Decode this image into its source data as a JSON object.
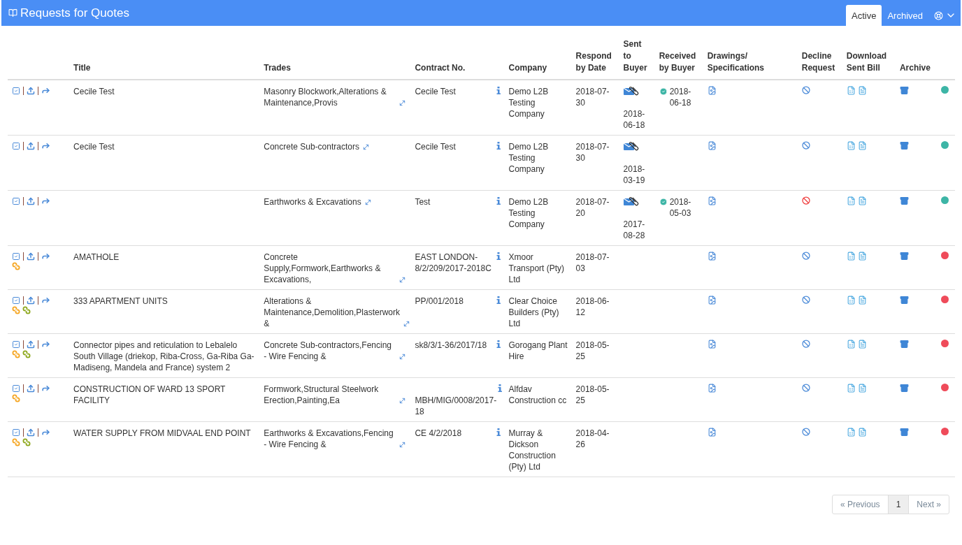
{
  "header": {
    "title": "Requests for Quotes",
    "tabs": [
      {
        "label": "Active",
        "selected": true
      },
      {
        "label": "Archived",
        "selected": false
      }
    ]
  },
  "table": {
    "columns": [
      "",
      "Title",
      "Trades",
      "Contract No.",
      "Company",
      "Respond by Date",
      "Sent to Buyer",
      "Received by Buyer",
      "Drawings/ Specifications",
      "Decline Request",
      "Download Sent Bill",
      "Archive"
    ],
    "rows": [
      {
        "links": [],
        "title": "Cecile Test",
        "trades": "Masonry Blockwork,Alterations & Maintenance,Provis",
        "contract": "Cecile Test",
        "company": "Demo L2B Testing Company",
        "respond": "2018-07-30",
        "sent": "2018-06-18",
        "received": "2018-06-18",
        "declined": false,
        "color": "#3db5a6"
      },
      {
        "links": [],
        "title": "Cecile Test",
        "trades": "Concrete Sub-contractors",
        "contract": "Cecile Test",
        "company": "Demo L2B Testing Company",
        "respond": "2018-07-30",
        "sent": "2018-03-19",
        "declined": false,
        "color": "#3db5a6"
      },
      {
        "links": [],
        "trades": "Earthworks & Excavations",
        "contract": "Test",
        "company": "Demo L2B Testing Company",
        "respond": "2018-07-20",
        "sent": "2017-08-28",
        "received": "2018-05-03",
        "declined": true,
        "color": "#3db5a6"
      },
      {
        "links": [
          {
            "color": "#f5a623"
          }
        ],
        "title": "AMATHOLE",
        "trades": "Concrete Supply,Formwork,Earthworks & Excavations,",
        "contract": "EAST LONDON-8/2/209/2017-2018C",
        "company": "Xmoor Transport (Pty) Ltd",
        "respond": "2018-07-03",
        "declined": false,
        "color": "#ef4b5a"
      },
      {
        "links": [
          {
            "color": "#f5a623"
          },
          {
            "color": "#8ea81e"
          }
        ],
        "title": "333 APARTMENT UNITS",
        "trades": "Alterations & Maintenance,Demolition,Plasterwork &",
        "contract": "PP/001/2018",
        "company": "Clear Choice Builders (Pty) Ltd",
        "respond": "2018-06-12",
        "declined": false,
        "color": "#ef4b5a"
      },
      {
        "links": [
          {
            "color": "#f5a623"
          },
          {
            "color": "#8ea81e"
          }
        ],
        "title": "Connector pipes and reticulation to Lebalelo South Village (driekop, Riba-Cross, Ga-Riba Ga-Madiseng, Mandela and France) system 2",
        "trades": "Concrete Sub-contractors,Fencing - Wire Fencing &",
        "contract": "sk8/3/1-36/2017/18",
        "company": "Gorogang Plant Hire",
        "respond": "2018-05-25",
        "declined": false,
        "color": "#ef4b5a"
      },
      {
        "links": [
          {
            "color": "#f5a623"
          }
        ],
        "title": "CONSTRUCTION OF WARD 13 SPORT FACILITY",
        "trades": "Formwork,Structural Steelwork Erection,Painting,Ea",
        "contract": "MBH/MIG/0008/2017-18",
        "company": "Alfdav Construction cc",
        "respond": "2018-05-25",
        "declined": false,
        "color": "#ef4b5a"
      },
      {
        "links": [
          {
            "color": "#f5a623"
          },
          {
            "color": "#8ea81e"
          }
        ],
        "title": "WATER SUPPLY FROM MIDVAAL END POINT",
        "trades": "Earthworks & Excavations,Fencing - Wire Fencing &",
        "contract": "CE 4/2/2018",
        "company": "Murray & Dickson Construction (Pty) Ltd",
        "respond": "2018-04-26",
        "declined": false,
        "color": "#ef4b5a"
      }
    ]
  },
  "pagination": [
    {
      "label": "« Previous",
      "selected": false
    },
    {
      "label": "1",
      "selected": true
    },
    {
      "label": "Next »",
      "selected": false
    }
  ]
}
